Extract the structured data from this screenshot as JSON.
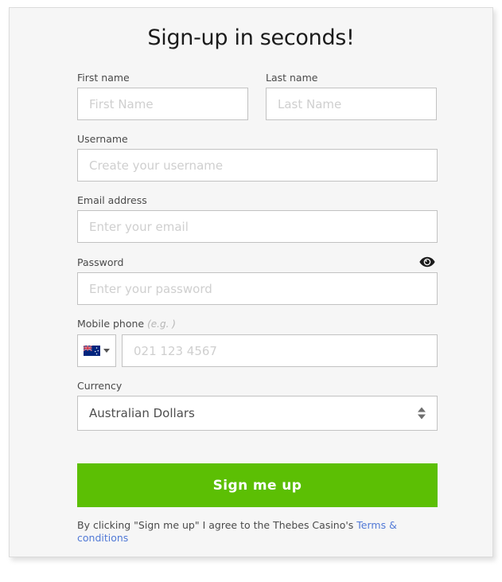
{
  "card": {
    "title": "Sign-up in seconds!"
  },
  "form": {
    "first_name": {
      "label": "First name",
      "placeholder": "First Name",
      "value": ""
    },
    "last_name": {
      "label": "Last name",
      "placeholder": "Last Name",
      "value": ""
    },
    "username": {
      "label": "Username",
      "placeholder": "Create your username",
      "value": ""
    },
    "email": {
      "label": "Email address",
      "placeholder": "Enter your email",
      "value": ""
    },
    "password": {
      "label": "Password",
      "placeholder": "Enter your password",
      "value": "",
      "toggle_icon": "eye-icon"
    },
    "mobile_phone": {
      "label": "Mobile phone",
      "label_hint": "(e.g. )",
      "placeholder": "021 123 4567",
      "value": "",
      "country_flag": "new-zealand-flag",
      "country_caret_icon": "chevron-down-icon"
    },
    "currency": {
      "label": "Currency",
      "selected": "Australian Dollars",
      "arrows_icon": "select-updown-arrows-icon"
    }
  },
  "submit": {
    "label": "Sign me up"
  },
  "terms": {
    "text_before": "By clicking \"Sign me up\" I agree to the Thebes Casino's ",
    "link_label": "Terms & conditions"
  },
  "colors": {
    "accent_green": "#5cbf04",
    "link_blue": "#5179d6",
    "card_bg": "#f6f6f6",
    "input_border": "#c2c2c2",
    "placeholder": "#cfcfcf"
  }
}
